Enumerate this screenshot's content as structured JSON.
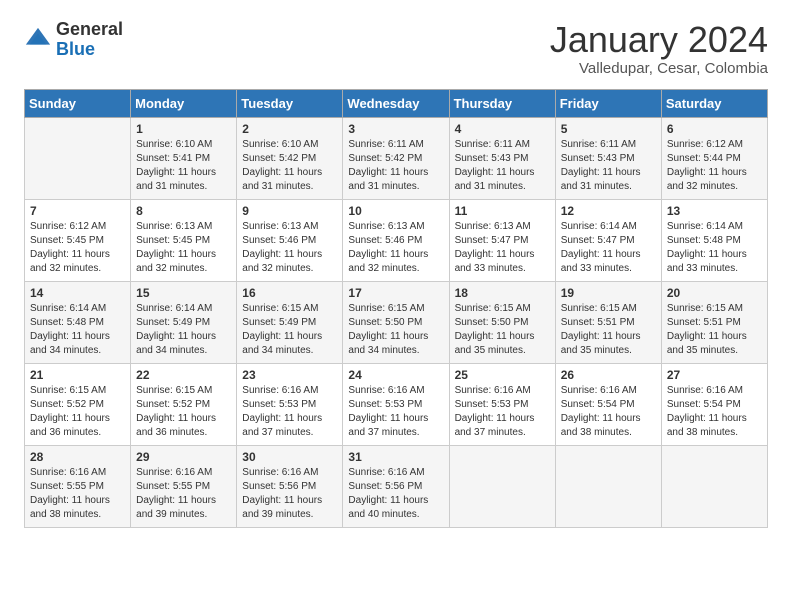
{
  "header": {
    "logo_general": "General",
    "logo_blue": "Blue",
    "title": "January 2024",
    "location": "Valledupar, Cesar, Colombia"
  },
  "days_of_week": [
    "Sunday",
    "Monday",
    "Tuesday",
    "Wednesday",
    "Thursday",
    "Friday",
    "Saturday"
  ],
  "weeks": [
    [
      {
        "day": "",
        "sunrise": "",
        "sunset": "",
        "daylight": ""
      },
      {
        "day": "1",
        "sunrise": "Sunrise: 6:10 AM",
        "sunset": "Sunset: 5:41 PM",
        "daylight": "Daylight: 11 hours and 31 minutes."
      },
      {
        "day": "2",
        "sunrise": "Sunrise: 6:10 AM",
        "sunset": "Sunset: 5:42 PM",
        "daylight": "Daylight: 11 hours and 31 minutes."
      },
      {
        "day": "3",
        "sunrise": "Sunrise: 6:11 AM",
        "sunset": "Sunset: 5:42 PM",
        "daylight": "Daylight: 11 hours and 31 minutes."
      },
      {
        "day": "4",
        "sunrise": "Sunrise: 6:11 AM",
        "sunset": "Sunset: 5:43 PM",
        "daylight": "Daylight: 11 hours and 31 minutes."
      },
      {
        "day": "5",
        "sunrise": "Sunrise: 6:11 AM",
        "sunset": "Sunset: 5:43 PM",
        "daylight": "Daylight: 11 hours and 31 minutes."
      },
      {
        "day": "6",
        "sunrise": "Sunrise: 6:12 AM",
        "sunset": "Sunset: 5:44 PM",
        "daylight": "Daylight: 11 hours and 32 minutes."
      }
    ],
    [
      {
        "day": "7",
        "sunrise": "Sunrise: 6:12 AM",
        "sunset": "Sunset: 5:45 PM",
        "daylight": "Daylight: 11 hours and 32 minutes."
      },
      {
        "day": "8",
        "sunrise": "Sunrise: 6:13 AM",
        "sunset": "Sunset: 5:45 PM",
        "daylight": "Daylight: 11 hours and 32 minutes."
      },
      {
        "day": "9",
        "sunrise": "Sunrise: 6:13 AM",
        "sunset": "Sunset: 5:46 PM",
        "daylight": "Daylight: 11 hours and 32 minutes."
      },
      {
        "day": "10",
        "sunrise": "Sunrise: 6:13 AM",
        "sunset": "Sunset: 5:46 PM",
        "daylight": "Daylight: 11 hours and 32 minutes."
      },
      {
        "day": "11",
        "sunrise": "Sunrise: 6:13 AM",
        "sunset": "Sunset: 5:47 PM",
        "daylight": "Daylight: 11 hours and 33 minutes."
      },
      {
        "day": "12",
        "sunrise": "Sunrise: 6:14 AM",
        "sunset": "Sunset: 5:47 PM",
        "daylight": "Daylight: 11 hours and 33 minutes."
      },
      {
        "day": "13",
        "sunrise": "Sunrise: 6:14 AM",
        "sunset": "Sunset: 5:48 PM",
        "daylight": "Daylight: 11 hours and 33 minutes."
      }
    ],
    [
      {
        "day": "14",
        "sunrise": "Sunrise: 6:14 AM",
        "sunset": "Sunset: 5:48 PM",
        "daylight": "Daylight: 11 hours and 34 minutes."
      },
      {
        "day": "15",
        "sunrise": "Sunrise: 6:14 AM",
        "sunset": "Sunset: 5:49 PM",
        "daylight": "Daylight: 11 hours and 34 minutes."
      },
      {
        "day": "16",
        "sunrise": "Sunrise: 6:15 AM",
        "sunset": "Sunset: 5:49 PM",
        "daylight": "Daylight: 11 hours and 34 minutes."
      },
      {
        "day": "17",
        "sunrise": "Sunrise: 6:15 AM",
        "sunset": "Sunset: 5:50 PM",
        "daylight": "Daylight: 11 hours and 34 minutes."
      },
      {
        "day": "18",
        "sunrise": "Sunrise: 6:15 AM",
        "sunset": "Sunset: 5:50 PM",
        "daylight": "Daylight: 11 hours and 35 minutes."
      },
      {
        "day": "19",
        "sunrise": "Sunrise: 6:15 AM",
        "sunset": "Sunset: 5:51 PM",
        "daylight": "Daylight: 11 hours and 35 minutes."
      },
      {
        "day": "20",
        "sunrise": "Sunrise: 6:15 AM",
        "sunset": "Sunset: 5:51 PM",
        "daylight": "Daylight: 11 hours and 35 minutes."
      }
    ],
    [
      {
        "day": "21",
        "sunrise": "Sunrise: 6:15 AM",
        "sunset": "Sunset: 5:52 PM",
        "daylight": "Daylight: 11 hours and 36 minutes."
      },
      {
        "day": "22",
        "sunrise": "Sunrise: 6:15 AM",
        "sunset": "Sunset: 5:52 PM",
        "daylight": "Daylight: 11 hours and 36 minutes."
      },
      {
        "day": "23",
        "sunrise": "Sunrise: 6:16 AM",
        "sunset": "Sunset: 5:53 PM",
        "daylight": "Daylight: 11 hours and 37 minutes."
      },
      {
        "day": "24",
        "sunrise": "Sunrise: 6:16 AM",
        "sunset": "Sunset: 5:53 PM",
        "daylight": "Daylight: 11 hours and 37 minutes."
      },
      {
        "day": "25",
        "sunrise": "Sunrise: 6:16 AM",
        "sunset": "Sunset: 5:53 PM",
        "daylight": "Daylight: 11 hours and 37 minutes."
      },
      {
        "day": "26",
        "sunrise": "Sunrise: 6:16 AM",
        "sunset": "Sunset: 5:54 PM",
        "daylight": "Daylight: 11 hours and 38 minutes."
      },
      {
        "day": "27",
        "sunrise": "Sunrise: 6:16 AM",
        "sunset": "Sunset: 5:54 PM",
        "daylight": "Daylight: 11 hours and 38 minutes."
      }
    ],
    [
      {
        "day": "28",
        "sunrise": "Sunrise: 6:16 AM",
        "sunset": "Sunset: 5:55 PM",
        "daylight": "Daylight: 11 hours and 38 minutes."
      },
      {
        "day": "29",
        "sunrise": "Sunrise: 6:16 AM",
        "sunset": "Sunset: 5:55 PM",
        "daylight": "Daylight: 11 hours and 39 minutes."
      },
      {
        "day": "30",
        "sunrise": "Sunrise: 6:16 AM",
        "sunset": "Sunset: 5:56 PM",
        "daylight": "Daylight: 11 hours and 39 minutes."
      },
      {
        "day": "31",
        "sunrise": "Sunrise: 6:16 AM",
        "sunset": "Sunset: 5:56 PM",
        "daylight": "Daylight: 11 hours and 40 minutes."
      },
      {
        "day": "",
        "sunrise": "",
        "sunset": "",
        "daylight": ""
      },
      {
        "day": "",
        "sunrise": "",
        "sunset": "",
        "daylight": ""
      },
      {
        "day": "",
        "sunrise": "",
        "sunset": "",
        "daylight": ""
      }
    ]
  ]
}
